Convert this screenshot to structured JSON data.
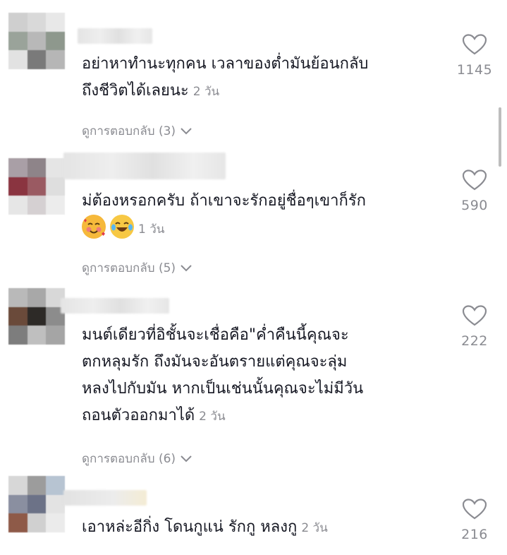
{
  "comments": [
    {
      "text": "อย่าหาทำนะทุกคน เวลาของต่ำมันย้อนกลับถึงชีวิตได้เลยนะ",
      "line1": "อย่าหาทำนะทุกคน เวลาของต่ำมันย้อนกลับ",
      "line2": "ถึงชีวิตได้เลยนะ",
      "time": "2 วัน",
      "replies": "ดูการตอบกลับ (3)",
      "likes": "1145"
    },
    {
      "line1": "ม่ต้องหรอกครับ ถ้าเขาจะรักอยู่ชื่อๆเขาก็รัก",
      "emojis": [
        "smiling-face-with-hearts-emoji",
        "tears-of-joy-emoji"
      ],
      "time": "1 วัน",
      "replies": "ดูการตอบกลับ (5)",
      "likes": "590"
    },
    {
      "line1": "มนต์เดียวที่อิชั้นจะเชื่อคือ\"ค่ำคืนนี้คุณจะ",
      "line2": "ตกหลุมรัก ถึงมันจะอันตรายแต่คุณจะลุ่ม",
      "line3": "หลงไปกับมัน หากเป็นเช่นนั้นคุณจะไม่มีวัน",
      "line4": "ถอนตัวออกมาได้",
      "time": "2 วัน",
      "replies": "ดูการตอบกลับ (6)",
      "likes": "222"
    },
    {
      "line1": "เอาหล่ะอีกิ่ง โดนกูแน่ รักกู หลงกู",
      "time": "2 วัน",
      "likes": "216"
    }
  ],
  "icons": {
    "like": "heart-outline-icon",
    "expand": "chevron-down-icon"
  },
  "colors": {
    "text": "#161823",
    "secondary": "#8a8b91",
    "background": "#ffffff"
  }
}
